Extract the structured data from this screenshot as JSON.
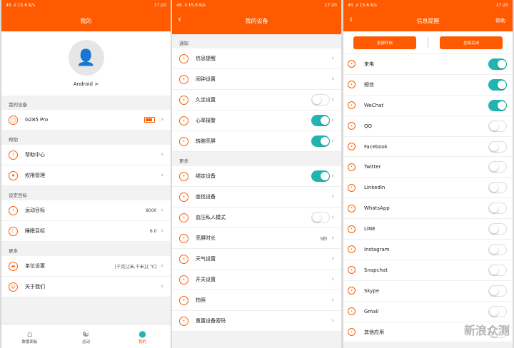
{
  "status": {
    "left": "46 .ıl 15.6 K/s",
    "right": "17:20"
  },
  "panel1": {
    "title": "我的",
    "username": "Android >",
    "sec_device": "我的设备",
    "device": "G285 Pro",
    "sec_help": "帮助",
    "help_center": "帮助中心",
    "permission": "权限管理",
    "sec_goal": "设定目标",
    "sport_goal": "运动目标",
    "sport_goal_val": "8000",
    "sleep_goal": "睡眠目标",
    "sleep_goal_val": "6.0",
    "sec_more": "更多",
    "unit": "单位设置",
    "unit_val": "[千克],[米,千米],[ ℃]",
    "about": "关于我们",
    "tabs": [
      "数据面板",
      "运动",
      "我的"
    ]
  },
  "panel2": {
    "title": "我的设备",
    "sec_notice": "通知",
    "rows1": [
      {
        "label": "信息提醒",
        "type": "chev"
      },
      {
        "label": "闹钟设置",
        "type": "chev"
      },
      {
        "label": "久坐设置",
        "type": "off"
      },
      {
        "label": "心率报警",
        "type": "on"
      },
      {
        "label": "转腕亮屏",
        "type": "on"
      }
    ],
    "sec_more": "更多",
    "rows2": [
      {
        "label": "绑定设备",
        "type": "on"
      },
      {
        "label": "查找设备",
        "type": "chev"
      },
      {
        "label": "血压私人模式",
        "type": "off"
      },
      {
        "label": "亮屏时长",
        "type": "val",
        "val": "5秒"
      },
      {
        "label": "天气设置",
        "type": "chev"
      },
      {
        "label": "开关设置",
        "type": "chev"
      },
      {
        "label": "拍照",
        "type": "chev"
      },
      {
        "label": "重置设备密码",
        "type": "chev"
      }
    ]
  },
  "panel3": {
    "title": "信息提醒",
    "help": "帮助",
    "all_on": "全部开启",
    "all_off": "全部关闭",
    "apps": [
      {
        "label": "来电",
        "on": true
      },
      {
        "label": "短信",
        "on": true
      },
      {
        "label": "WeChat",
        "on": true
      },
      {
        "label": "QQ",
        "on": false
      },
      {
        "label": "Facebook",
        "on": false
      },
      {
        "label": "Twitter",
        "on": false
      },
      {
        "label": "LinkedIn",
        "on": false
      },
      {
        "label": "WhatsApp",
        "on": false
      },
      {
        "label": "LINE",
        "on": false
      },
      {
        "label": "Instagram",
        "on": false
      },
      {
        "label": "Snapchat",
        "on": false
      },
      {
        "label": "Skype",
        "on": false
      },
      {
        "label": "Gmail",
        "on": false
      },
      {
        "label": "其他应用",
        "on": false
      }
    ],
    "watermark": "新浪众测"
  },
  "colors": {
    "accent": "#ff5a00",
    "toggle_on": "#22b5b0"
  }
}
